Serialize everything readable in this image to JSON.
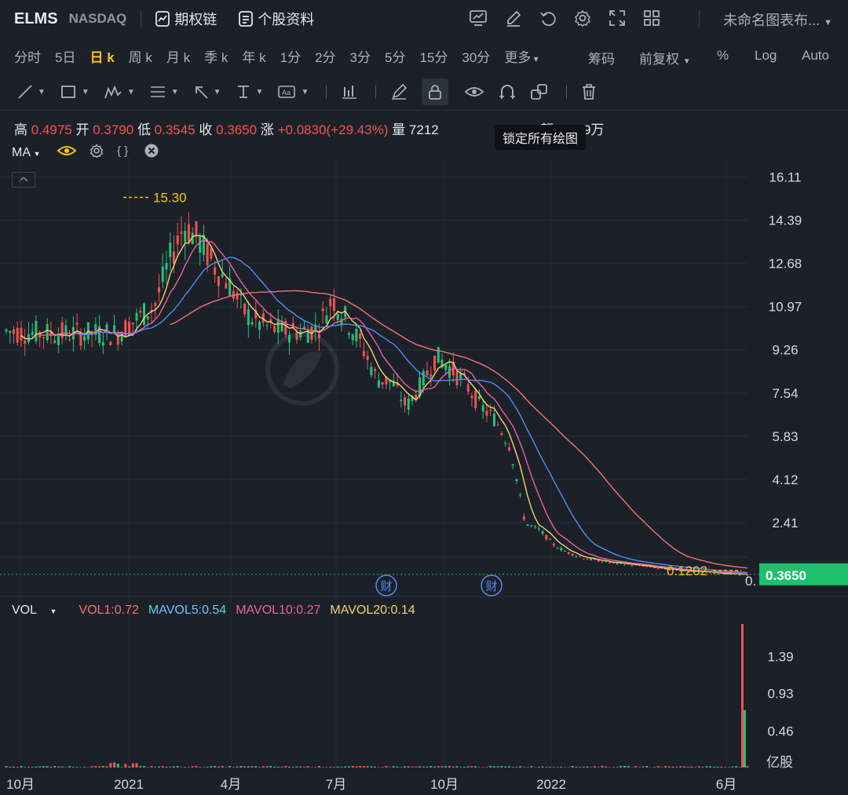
{
  "header": {
    "symbol": "ELMS",
    "exchange": "NASDAQ",
    "options_chain": "期权链",
    "stock_profile": "个股资料",
    "layout_name": "未命名图表布..."
  },
  "periods": [
    "分时",
    "5日",
    "日 k",
    "周 k",
    "月 k",
    "季 k",
    "年 k",
    "1分",
    "2分",
    "3分",
    "5分",
    "15分",
    "30分",
    "更多"
  ],
  "active_period": "日 k",
  "right_controls": {
    "chips": "筹码",
    "adjust": "前复权",
    "percent": "%",
    "log": "Log",
    "auto": "Auto"
  },
  "ohlc": {
    "high_label": "高",
    "high": "0.4975",
    "open_label": "开",
    "open": "0.3790",
    "low_label": "低",
    "low": "0.3545",
    "close_label": "收",
    "close": "0.3650",
    "change_label": "涨",
    "change": "+0.0830(+29.43%)",
    "volume_label": "量",
    "volume": "7212",
    "turnover_label": "额",
    "turnover": "38.29万"
  },
  "tooltip": "锁定所有绘图",
  "ma_legend": {
    "label": "MA"
  },
  "vol_legend": {
    "label": "VOL",
    "vol1": "VOL1:0.72",
    "mavol5": "MAVOL5:0.54",
    "mavol10": "MAVOL10:0.27",
    "mavol20": "MAVOL20:0.14"
  },
  "colors": {
    "up": "#26c07a",
    "down": "#f0534f",
    "ma5": "#f5d26e",
    "ma10": "#ec5fa2",
    "ma20": "#4f8ef0",
    "ma60": "#f07373",
    "vol1": "#f0736a",
    "mavol5": "#6cc4f5",
    "mavol10": "#ec5fa2",
    "mavol20": "#f5d26e",
    "last_price_bg": "#1fbf6c"
  },
  "chart_data": [
    {
      "type": "candlestick",
      "y_ticks": [
        "16.11",
        "14.39",
        "12.68",
        "10.97",
        "9.26",
        "7.54",
        "5.83",
        "4.12",
        "2.41"
      ],
      "ylim": [
        -0.2,
        16.9
      ],
      "x_ticks": [
        "10月",
        "2021",
        "4月",
        "7月",
        "10月",
        "2022",
        "6月"
      ],
      "last_price": "0.3650",
      "max_marker": "15.30",
      "min_marker": "0.1202",
      "partial_tick": "0.",
      "earnings_markers": [
        "财",
        "财"
      ],
      "series": [
        {
          "name": "price",
          "x": [
            0,
            5,
            10,
            15,
            20,
            22,
            24,
            26,
            28,
            30,
            32,
            34,
            36,
            38,
            40,
            42,
            44,
            46,
            48,
            50,
            52,
            54,
            56,
            58,
            60,
            62,
            64,
            66,
            68,
            70,
            72,
            74,
            76,
            78,
            80,
            82,
            84,
            86,
            88,
            90,
            92,
            94,
            96,
            98,
            100
          ],
          "y": [
            10.0,
            9.9,
            9.9,
            9.9,
            11.0,
            12.8,
            14.2,
            13.6,
            12.6,
            11.9,
            10.8,
            10.3,
            10.1,
            10.0,
            10.0,
            10.1,
            11.3,
            10.4,
            9.4,
            8.1,
            8.0,
            7.0,
            7.9,
            9.0,
            8.5,
            7.9,
            7.0,
            6.5,
            5.4,
            2.4,
            2.1,
            1.5,
            1.2,
            1.0,
            0.9,
            0.8,
            0.75,
            0.7,
            0.6,
            0.55,
            0.5,
            0.45,
            0.4,
            0.37,
            0.365
          ]
        }
      ]
    },
    {
      "type": "bar",
      "y_ticks": [
        "1.39",
        "0.93",
        "0.46"
      ],
      "unit": "亿股",
      "ylim": [
        0,
        1.85
      ],
      "last_volume": 0.72,
      "spike_volume": 1.8
    }
  ]
}
